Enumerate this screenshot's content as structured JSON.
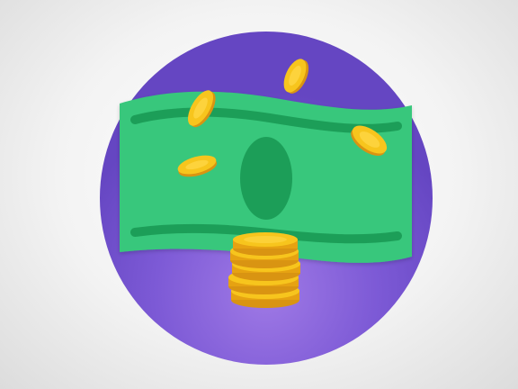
{
  "illustration": {
    "subject": "money",
    "elements": [
      "purple-circle-background",
      "green-banknote",
      "falling-gold-coins",
      "gold-coin-stack"
    ]
  },
  "colors": {
    "background": "#f2f2f2",
    "circle": "#6b4fc4",
    "circle_glow": "#a07ae6",
    "banknote": "#36c77a",
    "banknote_dark": "#1f9e59",
    "coin": "#f7c51d",
    "coin_shade": "#e6a212",
    "coin_edge": "#d99412"
  },
  "coin_stack_count": 5,
  "falling_coin_count": 4
}
